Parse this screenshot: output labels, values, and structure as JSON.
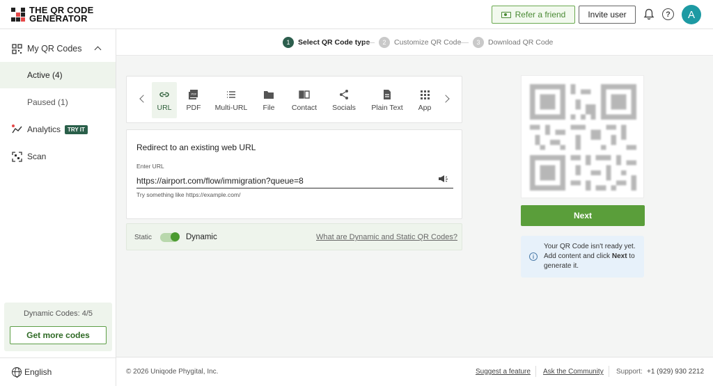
{
  "brand": {
    "line1": "THE QR CODE",
    "line2": "GENERATOR"
  },
  "header": {
    "refer_label": "Refer a friend",
    "invite_label": "Invite user",
    "avatar_initial": "A",
    "help_glyph": "?"
  },
  "sidebar": {
    "my_qr_codes": "My QR Codes",
    "active": "Active (4)",
    "paused": "Paused (1)",
    "analytics": "Analytics",
    "try_badge": "TRY IT",
    "scan": "Scan",
    "dynamic_codes": "Dynamic Codes: 4/5",
    "get_more": "Get more codes",
    "language": "English"
  },
  "stepper": {
    "steps": [
      {
        "num": "1",
        "label": "Select QR Code type"
      },
      {
        "num": "2",
        "label": "Customize QR Code"
      },
      {
        "num": "3",
        "label": "Download QR Code"
      }
    ]
  },
  "types": {
    "tabs": [
      {
        "label": "URL",
        "icon": "link-icon"
      },
      {
        "label": "PDF",
        "icon": "pdf-icon"
      },
      {
        "label": "Multi-URL",
        "icon": "list-icon"
      },
      {
        "label": "File",
        "icon": "folder-icon"
      },
      {
        "label": "Contact",
        "icon": "contact-card-icon"
      },
      {
        "label": "Socials",
        "icon": "share-icon"
      },
      {
        "label": "Plain Text",
        "icon": "document-icon"
      },
      {
        "label": "App",
        "icon": "app-grid-icon"
      }
    ]
  },
  "url_form": {
    "title": "Redirect to an existing web URL",
    "label": "Enter URL",
    "value": "https://airport.com/flow/immigration?queue=8",
    "hint": "Try something like https://example.com/"
  },
  "mode": {
    "static": "Static",
    "dynamic": "Dynamic",
    "help_link": "What are Dynamic and Static QR Codes?"
  },
  "preview": {
    "next_label": "Next",
    "notice_line1": "Your QR Code isn't ready yet. Add content and click ",
    "notice_bold": "Next",
    "notice_line2": " to generate it."
  },
  "footer": {
    "copyright": "© 2026 Uniqode Phygital, Inc.",
    "suggest": "Suggest a feature",
    "community": "Ask the Community",
    "support_label": "Support:",
    "support_phone": "+1 (929) 930 2212"
  },
  "colors": {
    "accent_green": "#5a9e3a",
    "dark_teal": "#2c5e4d",
    "avatar": "#1d9aa3"
  }
}
